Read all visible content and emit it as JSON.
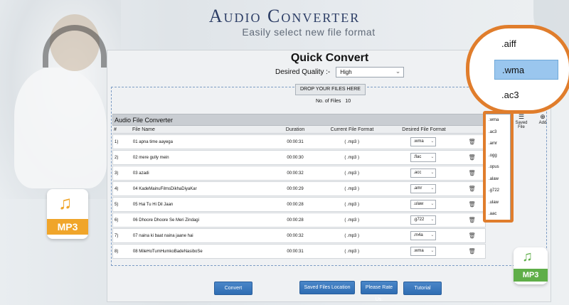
{
  "app": {
    "title": "Audio Converter",
    "subtitle": "Easily select new file format"
  },
  "panel": {
    "title": "Quick Convert",
    "quality_label": "Desired Quality :-",
    "quality_value": "High",
    "drop_button": "DROP YOUR FILES HERE",
    "files_label": "No. of Files",
    "files_count": "10"
  },
  "table": {
    "header": "Audio File Converter",
    "columns": [
      "#",
      "File Name",
      "Duration",
      "Current File Format",
      "Desired File Format"
    ],
    "rows": [
      {
        "idx": "1)",
        "name": "01 apna time aayega",
        "duration": "00:00:31",
        "current": "( .mp3 )",
        "desired": ".wma"
      },
      {
        "idx": "2)",
        "name": "02 mere gully mein",
        "duration": "00:00:30",
        "current": "( .mp3 )",
        "desired": ".flac"
      },
      {
        "idx": "3)",
        "name": "03 azadi",
        "duration": "00:00:32",
        "current": "( .mp3 )",
        "desired": ".acc"
      },
      {
        "idx": "4)",
        "name": "04 KadeMainuFilmsDikhaDiyaKar",
        "duration": "00:00:29",
        "current": "( .mp3 )",
        "desired": ".amr"
      },
      {
        "idx": "5)",
        "name": "05 Hai Tu Hi Dil Jaan",
        "duration": "00:00:28",
        "current": "( .mp3 )",
        "desired": ".ulaw"
      },
      {
        "idx": "6)",
        "name": "06 Dhoore Dhoore Se Meri Zindagi",
        "duration": "00:00:28",
        "current": "( .mp3 )",
        "desired": ".g722"
      },
      {
        "idx": "7)",
        "name": "07 naina ki baat naina jaane hai",
        "duration": "00:00:32",
        "current": "( .mp3 )",
        "desired": ".m4a"
      },
      {
        "idx": "8)",
        "name": "08 MileHoTumHumkoBadeNasiboSe",
        "duration": "00:00:31",
        "current": "( .mp3 )",
        "desired": ".wma"
      }
    ]
  },
  "side_tools": {
    "saved_file": "Saved File",
    "add": "Add"
  },
  "format_dropdown": {
    "options": [
      ".wma",
      ".ac3",
      ".amr",
      ".ogg",
      ".opus",
      ".alaw",
      ".g722",
      ".ulaw",
      ".aac"
    ]
  },
  "zoom": {
    "options": [
      ".aiff",
      ".wma",
      ".ac3"
    ],
    "selected": ".wma"
  },
  "buttons": {
    "convert": "Convert",
    "saved_location": "Saved Files Location",
    "rate": "Please Rate Us.",
    "tutorial": "Tutorial"
  },
  "icons": {
    "mp3_left": "MP3",
    "mp3_right": "MP3"
  },
  "colors": {
    "accent": "#2f6db3",
    "highlight": "#e07d2c",
    "title": "#2d3e66"
  }
}
